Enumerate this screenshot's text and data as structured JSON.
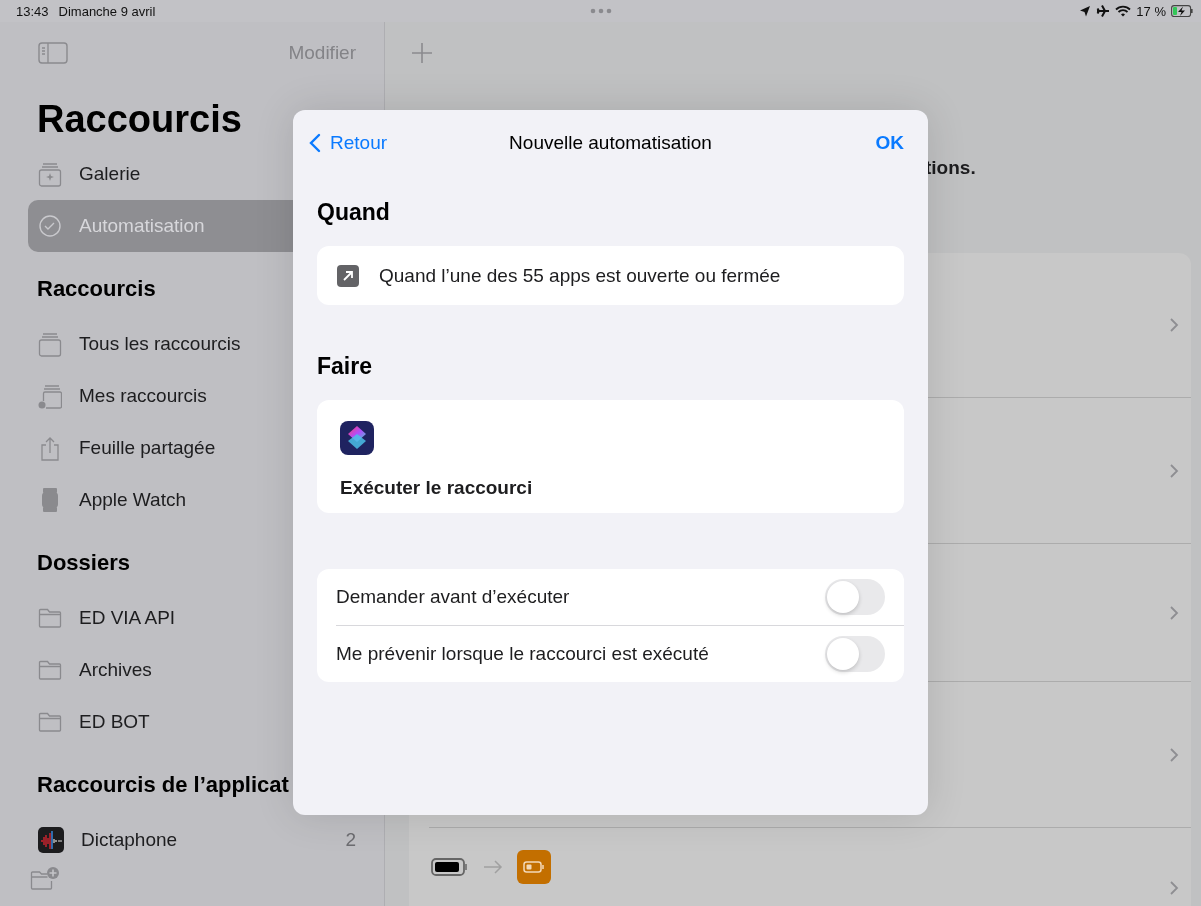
{
  "status_bar": {
    "time": "13:43",
    "date": "Dimanche 9 avril",
    "battery_percent": "17 %",
    "charging": true
  },
  "sidebar": {
    "edit_button": "Modifier",
    "title": "Raccourcis",
    "top_items": [
      {
        "label": "Galerie",
        "selected": false
      },
      {
        "label": "Automatisation",
        "selected": true
      }
    ],
    "sections": [
      {
        "title": "Raccourcis",
        "items": [
          {
            "label": "Tous les raccourcis",
            "selected": false
          },
          {
            "label": "Mes raccourcis",
            "selected": false
          },
          {
            "label": "Feuille partagée",
            "selected": false
          },
          {
            "label": "Apple Watch",
            "selected": false
          }
        ]
      },
      {
        "title": "Dossiers",
        "items": [
          {
            "label": "ED VIA API",
            "selected": false
          },
          {
            "label": "Archives",
            "selected": false
          },
          {
            "label": "ED BOT",
            "selected": false
          }
        ]
      },
      {
        "title": "Raccourcis de l’applicat",
        "items": [
          {
            "label": "Dictaphone",
            "selected": false,
            "count": "2"
          }
        ]
      }
    ]
  },
  "main": {
    "subtitle_fragment": "tions."
  },
  "modal": {
    "back": "Retour",
    "title": "Nouvelle automatisation",
    "done": "OK",
    "sections": [
      {
        "title": "Quand",
        "kind": "trigger",
        "text": "Quand l’une des 55 apps est ouverte ou fermée"
      },
      {
        "title": "Faire",
        "kind": "action",
        "text": "Exécuter le raccourci"
      }
    ],
    "options": [
      {
        "label": "Demander avant d’exécuter",
        "on": false
      },
      {
        "label": "Me prévenir lorsque le raccourci est exécuté",
        "on": false
      }
    ]
  }
}
